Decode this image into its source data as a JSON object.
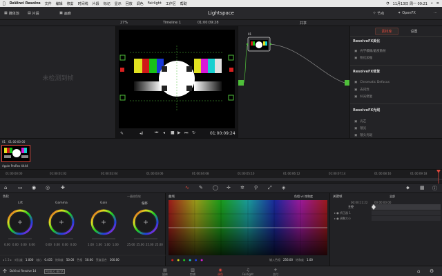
{
  "menubar": {
    "app": "DaVinci Resolve",
    "items": [
      "文件",
      "编辑",
      "修剪",
      "时间线",
      "片段",
      "标记",
      "显示",
      "回放",
      "调色",
      "Fairlight",
      "工作区",
      "帮助"
    ],
    "datetime": "11月13日 周一 09:21"
  },
  "titlebar": {
    "media_pool": "媒体池",
    "clips": "片段",
    "gallery": "画廊",
    "title": "Lightspace",
    "nodes": "节点",
    "openfx": "OpenFX"
  },
  "subbar": {
    "zoom": "27%",
    "timeline": "Timeline 1",
    "timecode": "01:00:09:28",
    "shared": "共享"
  },
  "leftpanel": {
    "empty": "未检测到帧"
  },
  "viewer": {
    "timecode": "01:00:09:24"
  },
  "nodes": {
    "node_label": "01"
  },
  "fx": {
    "tab_active": "素材库",
    "tab_other": "设置",
    "sections": [
      {
        "title": "ResolveFX美化",
        "items": [
          "光学模糊/磨皮散射",
          "锐化加强"
        ]
      },
      {
        "title": "ResolveFX修复",
        "items": [
          "Chromatic Defocus",
          "去闪烁",
          "补光修复"
        ]
      },
      {
        "title": "ResolveFX光线",
        "items": [
          "光芒",
          "镜光",
          "镜头光斑"
        ]
      }
    ]
  },
  "clip": {
    "index": "01",
    "timecode": "01:00:00:00",
    "codec": "Apple ProRes 4444"
  },
  "ruler": {
    "ticks": [
      "01:00:00:00",
      "01:00:01:02",
      "01:00:02:04",
      "01:00:03:06",
      "01:00:04:08",
      "01:00:05:10",
      "01:00:06:12",
      "01:00:07:14",
      "01:00:08:16",
      "01:00:09:18"
    ]
  },
  "wheels": {
    "title": "色轮",
    "names": [
      "Lift",
      "Gamma",
      "Gain",
      "偏移"
    ],
    "values": [
      [
        "0.00",
        "0.00",
        "0.00",
        "0.00"
      ],
      [
        "0.00",
        "0.00",
        "0.00",
        "0.00"
      ],
      [
        "1.00",
        "1.00",
        "1.00",
        "1.00"
      ],
      [
        "25.00",
        "25.00",
        "25.00",
        "25.00"
      ]
    ],
    "footer": {
      "contrast_label": "对比度",
      "contrast": "1.000",
      "pivot_label": "轴心",
      "pivot": "0.435",
      "sat_label": "饱和度",
      "sat": "50.00",
      "hue_label": "色相",
      "hue": "50.00",
      "lum_label": "亮度混合",
      "lum": "100.00"
    },
    "primary": "一级校色轮"
  },
  "curves": {
    "title": "曲线",
    "mode": "色相 vs 饱和度",
    "input_label": "输入色相",
    "input": "256.00",
    "sat_label": "饱和度",
    "sat": "1.00"
  },
  "keyer": {
    "title": "关键帧",
    "timecode": "00:00:11:22",
    "timecode2": "00:00:00:00",
    "dropdown": "全部",
    "rows": [
      "主控",
      "矫正器 1",
      "调整大小"
    ]
  },
  "bottombar": {
    "app": "DaVinci Resolve 14",
    "beta": "PUBLIC BETA",
    "pages": [
      "媒体",
      "剪辑",
      "调色",
      "Fairlight",
      "交付"
    ],
    "active_page": 2
  },
  "colors": {
    "accent": "#e0483c",
    "panel": "#232326",
    "viewer_bg": "#141416",
    "node_green": "#4fbf3a"
  }
}
